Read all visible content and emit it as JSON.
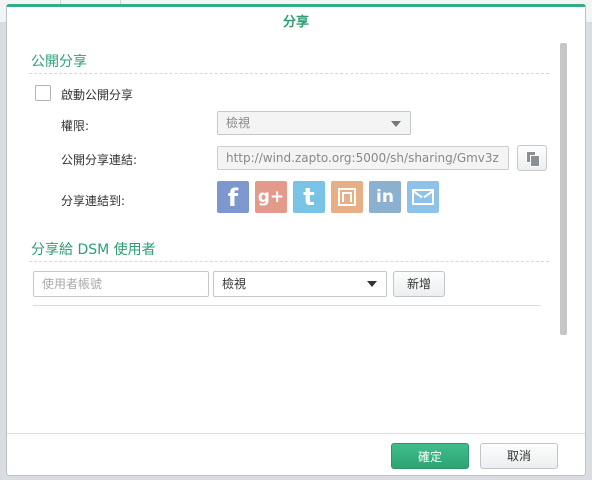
{
  "dialog": {
    "title": "分享",
    "accent_color": "#34ad80"
  },
  "public_share": {
    "section_title": "公開分享",
    "enable_label": "啟動公開分享",
    "enabled": false,
    "permission_label": "權限:",
    "permission_value": "檢視",
    "link_label": "公開分享連結:",
    "link_value": "http://wind.zapto.org:5000/sh/sharing/Gmv3z",
    "share_to_label": "分享連結到:",
    "social_icons": [
      {
        "name": "facebook-icon",
        "glyph": "f",
        "color": "#7e98cf"
      },
      {
        "name": "google-plus-icon",
        "glyph": "g+",
        "color": "#e49a8a"
      },
      {
        "name": "twitter-icon",
        "glyph": "t",
        "color": "#79c3e6"
      },
      {
        "name": "plurk-icon",
        "glyph": "",
        "color": "#e8ae85"
      },
      {
        "name": "linkedin-icon",
        "glyph": "in",
        "color": "#8cb0cf"
      },
      {
        "name": "mail-icon",
        "glyph": "",
        "color": "#8fc2e8"
      }
    ]
  },
  "dsm_share": {
    "section_title": "分享給 DSM 使用者",
    "user_placeholder": "使用者帳號",
    "permission_value": "檢視",
    "add_label": "新增"
  },
  "footer": {
    "ok_label": "確定",
    "cancel_label": "取消"
  }
}
